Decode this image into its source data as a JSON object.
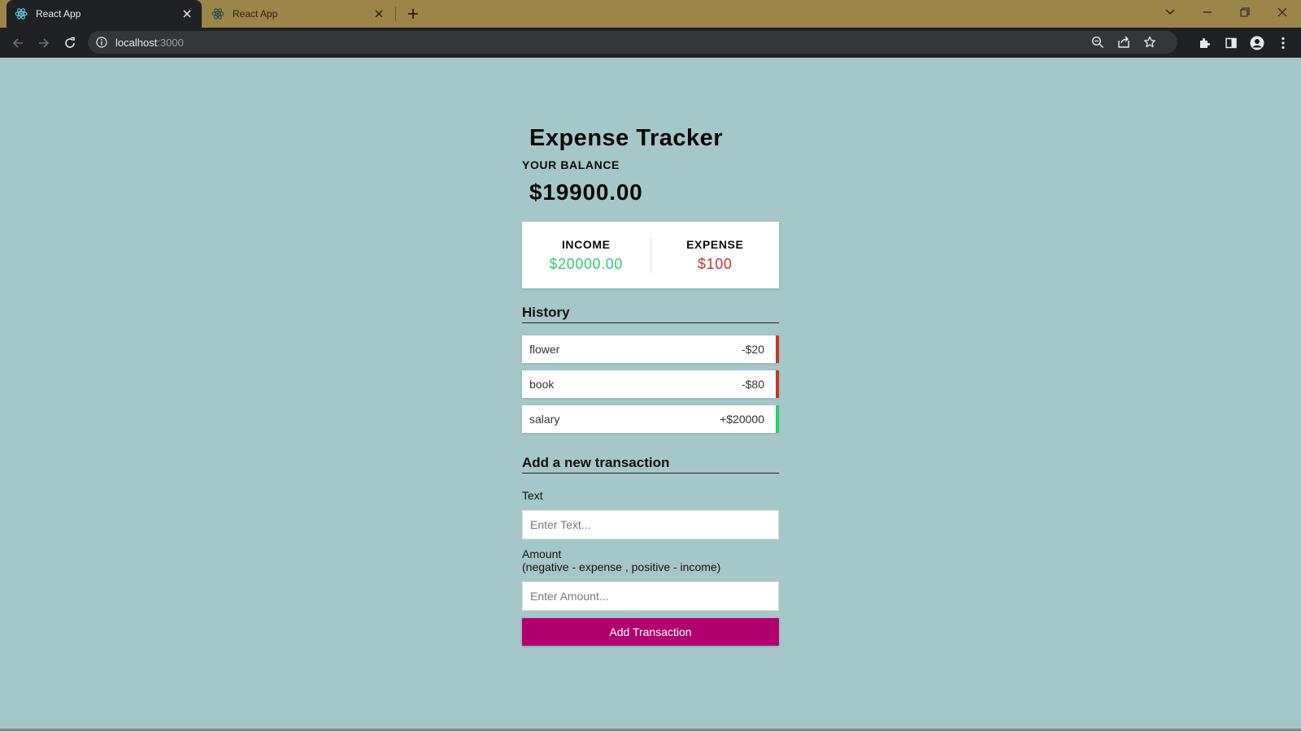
{
  "browser": {
    "tabs": [
      {
        "title": "React App",
        "active": true
      },
      {
        "title": "React App",
        "active": false
      }
    ],
    "address": {
      "host": "localhost",
      "port": ":3000"
    },
    "icons": {
      "favicon": "react-atom-icon",
      "back": "arrow-left-icon",
      "forward": "arrow-right-icon",
      "reload": "reload-icon",
      "site_info": "info-icon",
      "zoom": "zoom-icon",
      "share": "share-icon",
      "bookmark": "star-icon",
      "extensions": "puzzle-icon",
      "side_panel": "side-panel-icon",
      "profile": "profile-icon",
      "menu": "kebab-menu-icon"
    },
    "colors": {
      "tabstrip": "#9b8548",
      "toolbar": "#202124"
    }
  },
  "app": {
    "title": "Expense Tracker",
    "balance_label": "YOUR BALANCE",
    "balance": "$19900.00",
    "income_label": "INCOME",
    "income": "$20000.00",
    "expense_label": "EXPENSE",
    "expense": "$100",
    "history_title": "History",
    "transactions": [
      {
        "text": "flower",
        "amount": "-$20",
        "type": "minus"
      },
      {
        "text": "book",
        "amount": "-$80",
        "type": "minus"
      },
      {
        "text": "salary",
        "amount": "+$20000",
        "type": "plus"
      }
    ],
    "form": {
      "title": "Add a new transaction",
      "text_label": "Text",
      "text_placeholder": "Enter Text...",
      "amount_label": "Amount",
      "amount_hint": "(negative - expense , positive - income)",
      "amount_placeholder": "Enter Amount...",
      "submit_label": "Add Transaction"
    },
    "colors": {
      "background": "#a6c7ca",
      "income": "#2ecc71",
      "expense": "#c0392b",
      "button": "#b1006e"
    }
  }
}
